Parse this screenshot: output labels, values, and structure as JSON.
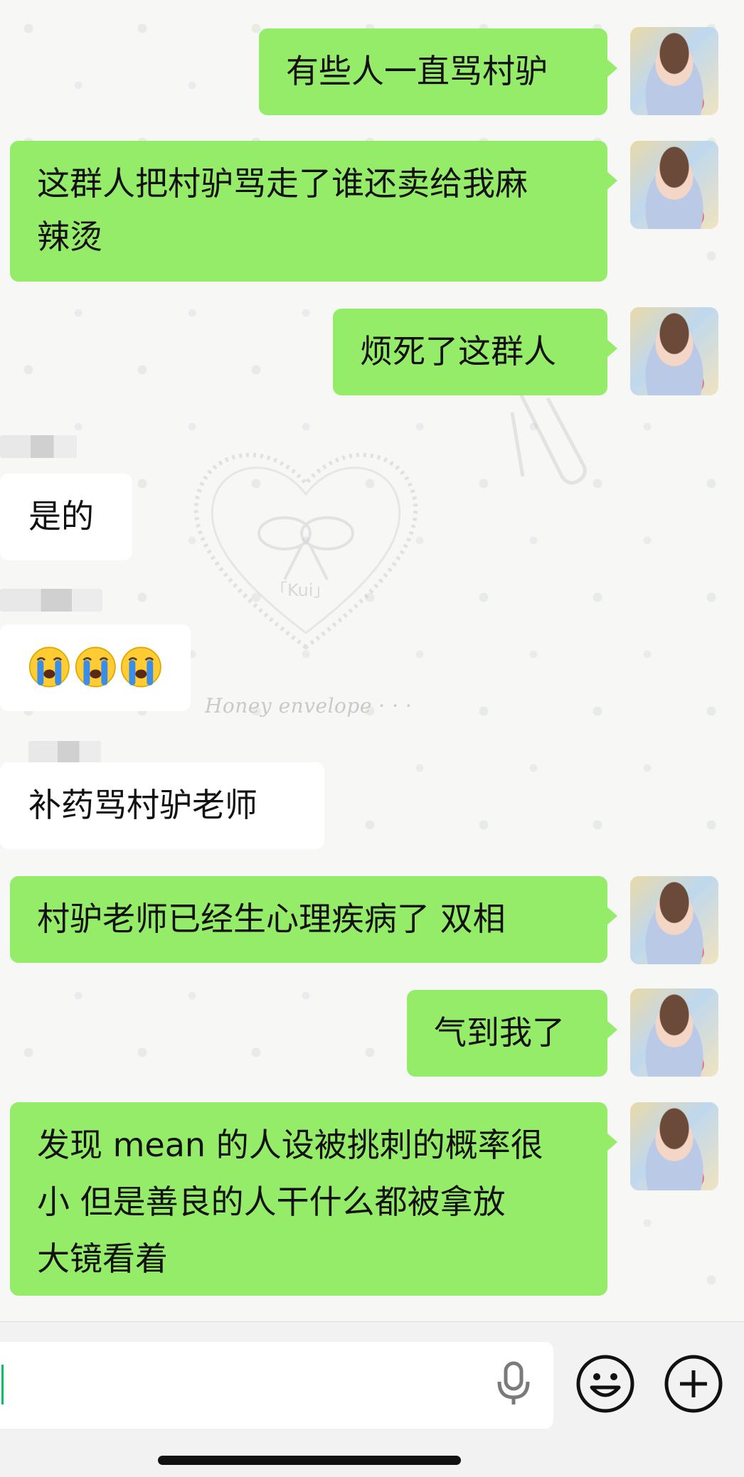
{
  "messages": [
    {
      "side": "out",
      "text": "有些人一直骂村驴"
    },
    {
      "side": "out",
      "lines": [
        "这群人把村驴骂走了谁还卖给我麻",
        "辣烫"
      ]
    },
    {
      "side": "out",
      "text": "烦死了这群人"
    },
    {
      "side": "in",
      "text": "是的"
    },
    {
      "side": "in",
      "emoji": [
        "loudly-crying-face",
        "loudly-crying-face",
        "loudly-crying-face"
      ]
    },
    {
      "side": "in",
      "text": "补药骂村驴老师"
    },
    {
      "side": "out",
      "text": "村驴老师已经生心理疾病了 双相"
    },
    {
      "side": "out",
      "text": "气到我了"
    },
    {
      "side": "out",
      "lines": [
        "发现 mean 的人设被挑刺的概率很",
        "小 但是善良的人干什么都被拿放",
        "大镜看着"
      ]
    }
  ],
  "background": {
    "heart_label": "「Kui」",
    "watermark": "Honey envelope · · ·"
  },
  "input_bar": {
    "value": "",
    "icons": [
      "microphone-icon",
      "emoji-icon",
      "plus-icon"
    ]
  },
  "colors": {
    "outgoing_bubble": "#95ec69",
    "incoming_bubble": "#ffffff",
    "chat_background": "#f7f8f6",
    "input_bar_background": "#f2f2f2",
    "caret": "#07c160"
  }
}
